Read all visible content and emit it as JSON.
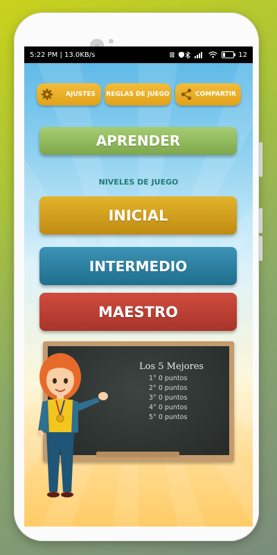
{
  "status_bar": {
    "left_text": "5:22 PM | 13.0KB/s",
    "battery": "12"
  },
  "top_buttons": {
    "ajustes": "AJUSTES",
    "reglas": "REGLAS DE JUEGO",
    "compartir": "COMPARTIR"
  },
  "aprender": "APRENDER",
  "niveles_title": "NIVELES DE JUEGO",
  "levels": {
    "inicial": "INICIAL",
    "intermedio": "INTERMEDIO",
    "maestro": "MAESTRO"
  },
  "scoreboard": {
    "title": "Los 5 Mejores",
    "entries": [
      "1°  0 puntos",
      "2°  0 puntos",
      "3°  0 puntos",
      "4°  0 puntos",
      "5°  0 puntos"
    ]
  },
  "icons": {
    "ajustes": "gear-icon",
    "compartir": "share-icon"
  },
  "colors": {
    "aprender": "#8fb85d",
    "inicial": "#d09f1e",
    "intermedio": "#2c82a3",
    "maestro": "#bc3f34",
    "top_button": "#eab02a"
  }
}
